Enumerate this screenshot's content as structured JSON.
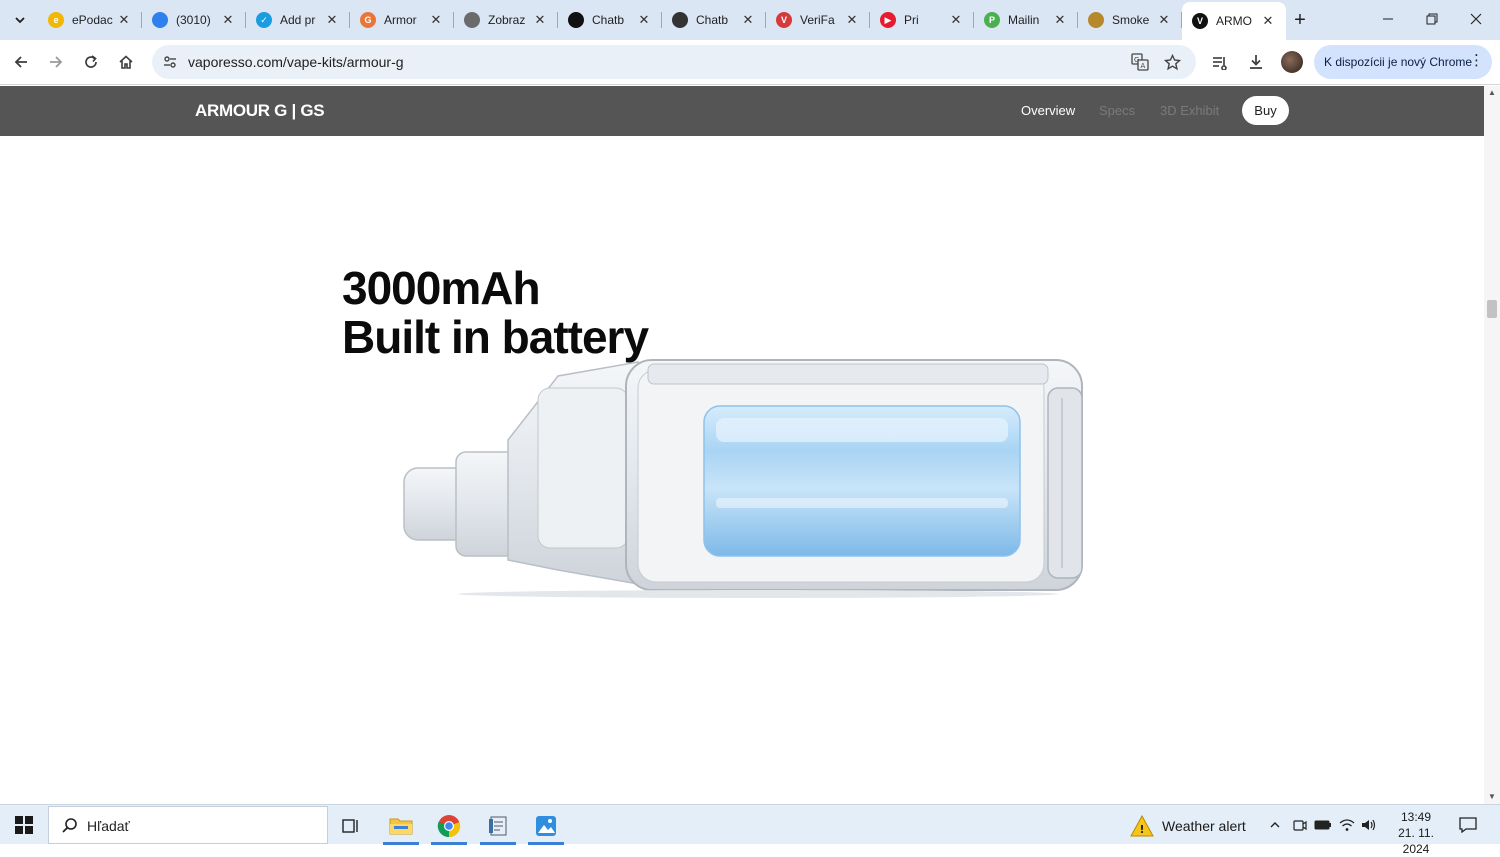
{
  "browser": {
    "tabs": [
      {
        "title": "ePodac",
        "favicon": "epodacia-icon",
        "color": "#f2b705",
        "glyph": "e"
      },
      {
        "title": "(3010)",
        "favicon": "mail-icon",
        "color": "#2f80ed",
        "glyph": ""
      },
      {
        "title": "Add pr",
        "favicon": "edit-icon",
        "color": "#1a9ce0",
        "glyph": "✓"
      },
      {
        "title": "Armor",
        "favicon": "google-icon",
        "color": "#e8753a",
        "glyph": "G"
      },
      {
        "title": "Zobraz",
        "favicon": "globe-icon",
        "color": "#6b6b6b",
        "glyph": ""
      },
      {
        "title": "Chatb",
        "favicon": "chatgpt-icon",
        "color": "#111111",
        "glyph": ""
      },
      {
        "title": "Chatb",
        "favicon": "chatgpt-icon",
        "color": "#333333",
        "glyph": ""
      },
      {
        "title": "VeriFa",
        "favicon": "verifact-icon",
        "color": "#d63a3a",
        "glyph": "V"
      },
      {
        "title": "Pri",
        "favicon": "youtube-music-icon",
        "color": "#e61b2d",
        "glyph": "▶"
      },
      {
        "title": "Mailin",
        "favicon": "mailing-icon",
        "color": "#4caf50",
        "glyph": "P"
      },
      {
        "title": "Smoke",
        "favicon": "smoke-icon",
        "color": "#b68a2c",
        "glyph": ""
      },
      {
        "title": "ARMO",
        "favicon": "vaporesso-icon",
        "color": "#111111",
        "glyph": "V",
        "active": true
      }
    ],
    "url": "vaporesso.com/vape-kits/armour-g",
    "chrome_notice": "K dispozícii je nový Chrome"
  },
  "site": {
    "brand": "ARMOUR G | GS",
    "nav": {
      "overview": "Overview",
      "specs": "Specs",
      "exhibit": "3D Exhibit",
      "buy": "Buy"
    },
    "headline_line1": "3000mAh",
    "headline_line2": "Built in battery"
  },
  "taskbar": {
    "search_placeholder": "Hľadať",
    "weather": "Weather alert",
    "time": "13:49",
    "date": "21. 11. 2024"
  },
  "colors": {
    "nav_bg": "#555555",
    "tabstrip_bg": "#dbe6f5",
    "taskbar_bg": "#e4eef8",
    "notice_bg": "#d3e3fd"
  }
}
